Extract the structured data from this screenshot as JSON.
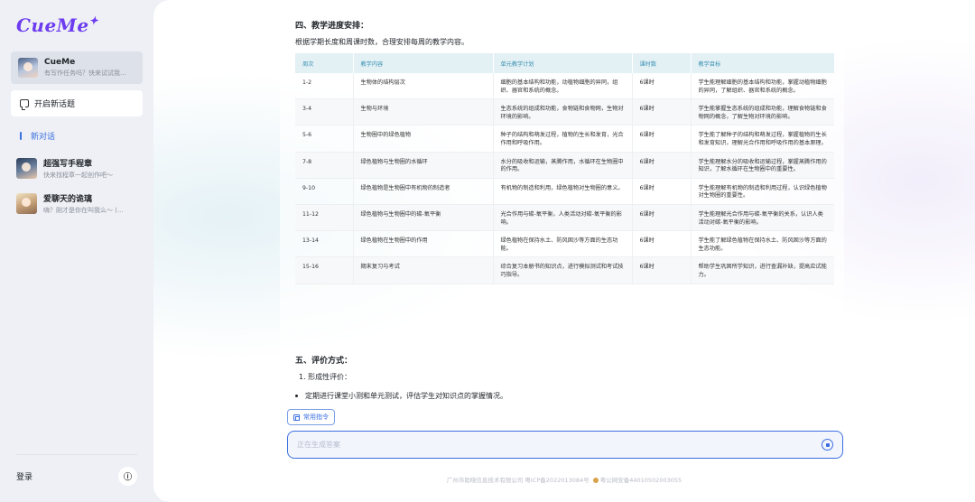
{
  "sidebar": {
    "logo": "CueMe",
    "current_chat": {
      "title": "CueMe",
      "subtitle": "有写作任务吗？快来试试我..."
    },
    "new_topic_label": "开启新话题",
    "new_chat_label": "新对话",
    "agents": [
      {
        "title": "超强写手程章",
        "subtitle": "快来找程章一起创作吧～"
      },
      {
        "title": "爱聊天的诡璃",
        "subtitle": "嗨？刚才是你在叫我么～ (..."
      }
    ],
    "login_label": "登录"
  },
  "content": {
    "section4_title": "四、教学进度安排：",
    "section4_intro": "根据学期长度和周课时数，合理安排每周的教学内容。",
    "table": {
      "headers": [
        "周次",
        "教学内容",
        "单元教学计划",
        "课时数",
        "教学目标"
      ],
      "rows": [
        [
          "1-2",
          "生物体的结构层次",
          "细胞的基本结构和功能，动植物细胞的异同，组织、器官和系统的概念。",
          "6课时",
          "学生能理解细胞的基本结构和功能，掌握动植物细胞的异同，了解组织、器官和系统的概念。"
        ],
        [
          "3-4",
          "生物与环境",
          "生态系统的组成和功能，食物链和食物网，生物对环境的影响。",
          "6课时",
          "学生能掌握生态系统的组成和功能，理解食物链和食物网的概念，了解生物对环境的影响。"
        ],
        [
          "5-6",
          "生物圈中的绿色植物",
          "种子的结构和萌发过程，植物的生长和发育，光合作用和呼吸作用。",
          "6课时",
          "学生能了解种子的结构和萌发过程，掌握植物的生长和发育知识，理解光合作用和呼吸作用的基本原理。"
        ],
        [
          "7-8",
          "绿色植物与生物圈的水循环",
          "水分的吸收和运输，蒸腾作用，水循环在生物圈中的作用。",
          "6课时",
          "学生能理解水分的吸收和运输过程，掌握蒸腾作用的知识，了解水循环在生物圈中的重要性。"
        ],
        [
          "9-10",
          "绿色植物是生物圈中有机物的制造者",
          "有机物的制造和利用，绿色植物对生物圈的意义。",
          "6课时",
          "学生能理解有机物的制造和利用过程，认识绿色植物对生物圈的重要性。"
        ],
        [
          "11-12",
          "绿色植物与生物圈中的碳-氧平衡",
          "光合作用与碳-氧平衡，人类活动对碳-氧平衡的影响。",
          "6课时",
          "学生能理解光合作用与碳-氧平衡的关系，认识人类活动对碳-氧平衡的影响。"
        ],
        [
          "13-14",
          "绿色植物在生物圈中的作用",
          "绿色植物在保持水土、防风固沙等方面的生态功能。",
          "6课时",
          "学生能了解绿色植物在保持水土、防风固沙等方面的生态功能。"
        ],
        [
          "15-16",
          "期末复习与考试",
          "综合复习本册书的知识点，进行模拟测试和考试技巧指导。",
          "6课时",
          "帮助学生巩固所学知识，进行查漏补缺，提高应试能力。"
        ]
      ]
    },
    "section5_title": "五、评价方式：",
    "section5_sub1": "1. 形成性评价：",
    "section5_bullet1": "定期进行课堂小测和单元测试，评估学生对知识点的掌握情况。"
  },
  "composer": {
    "common_commands_label": "常用指令",
    "input_placeholder": "正在生成答案"
  },
  "footer": {
    "company_icp": "广州市助晓信息技术有限公司 粤ICP备2022013084号",
    "police": "粤公网安备44010502003055"
  },
  "colors": {
    "accent": "#3b6fe0",
    "logo": "#6d3cf0",
    "table_header_bg": "#e3f1f5",
    "table_header_text": "#3a8fb0"
  }
}
